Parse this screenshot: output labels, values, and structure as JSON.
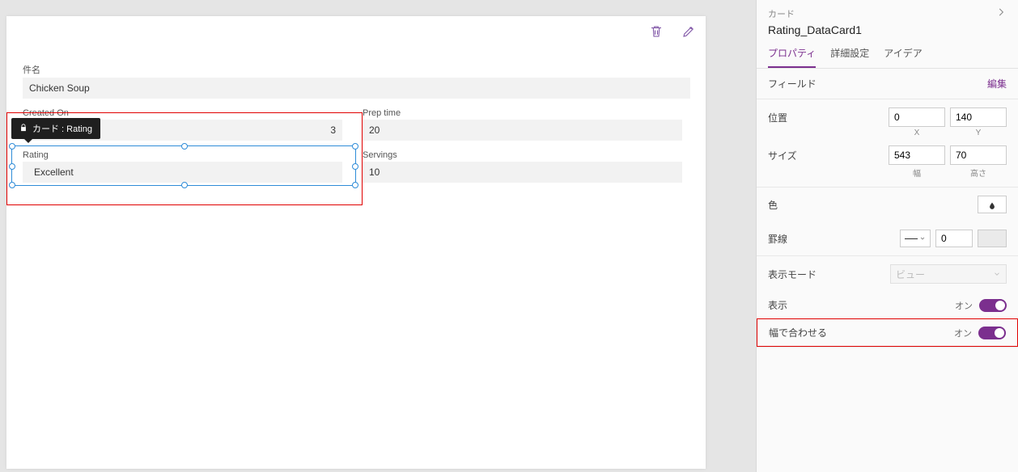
{
  "tooltip": {
    "label": "カード : Rating"
  },
  "fields": {
    "subject": {
      "label": "件名",
      "value": "Chicken Soup"
    },
    "createdOn": {
      "label": "Created On",
      "value": "3"
    },
    "prepTime": {
      "label": "Prep time",
      "value": "20"
    },
    "rating": {
      "label": "Rating",
      "value": "Excellent"
    },
    "servings": {
      "label": "Servings",
      "value": "10"
    }
  },
  "panel": {
    "typeLabel": "カード",
    "name": "Rating_DataCard1",
    "tabs": {
      "properties": "プロパティ",
      "advanced": "詳細設定",
      "ideas": "アイデア"
    },
    "fieldLabel": "フィールド",
    "editLink": "編集",
    "position": {
      "label": "位置",
      "x": "0",
      "y": "140",
      "xLabel": "X",
      "yLabel": "Y"
    },
    "size": {
      "label": "サイズ",
      "w": "543",
      "h": "70",
      "wLabel": "幅",
      "hLabel": "高さ"
    },
    "color": {
      "label": "色"
    },
    "border": {
      "label": "罫線",
      "value": "0"
    },
    "displayMode": {
      "label": "表示モード",
      "value": "ビュー"
    },
    "visible": {
      "label": "表示",
      "state": "オン"
    },
    "widthFit": {
      "label": "幅で合わせる",
      "state": "オン"
    }
  }
}
